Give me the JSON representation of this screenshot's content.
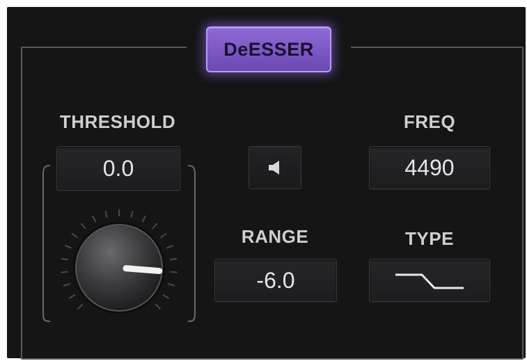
{
  "module": {
    "title": "DeESSER"
  },
  "threshold": {
    "label": "THRESHOLD",
    "value": "0.0",
    "knob_level": 0.85
  },
  "freq": {
    "label": "FREQ",
    "value": "4490"
  },
  "range": {
    "label": "RANGE",
    "value": "-6.0"
  },
  "type": {
    "label": "TYPE",
    "icon": "highpass-shelf-icon"
  },
  "listen": {
    "icon": "speaker-icon"
  },
  "colors": {
    "accent": "#8f6ad6",
    "panel_bg": "#151516",
    "text": "#cfcfd1"
  }
}
